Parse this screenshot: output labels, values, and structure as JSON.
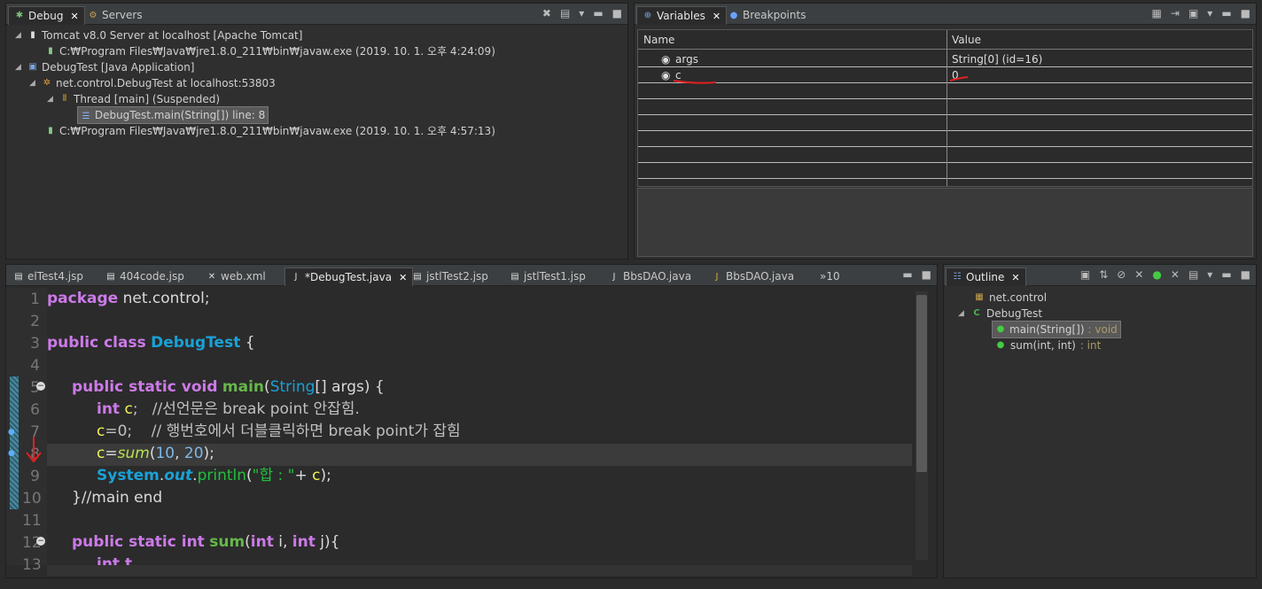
{
  "debug": {
    "tabs": [
      {
        "label": "Debug",
        "close": "✕",
        "icon": "bug-icon"
      },
      {
        "label": "Servers",
        "icon": "servers-icon"
      }
    ],
    "tree": [
      "Tomcat v8.0 Server at localhost [Apache Tomcat]",
      "C:₩Program Files₩Java₩jre1.8.0_211₩bin₩javaw.exe (2019. 10. 1. 오후 4:24:09)",
      "DebugTest [Java Application]",
      "net.control.DebugTest at localhost:53803",
      "Thread [main] (Suspended)",
      "DebugTest.main(String[]) line: 8",
      "C:₩Program Files₩Java₩jre1.8.0_211₩bin₩javaw.exe (2019. 10. 1. 오후 4:57:13)"
    ]
  },
  "variables": {
    "tabs": [
      {
        "label": "Variables",
        "close": "✕"
      },
      {
        "label": "Breakpoints"
      }
    ],
    "headers": {
      "name": "Name",
      "value": "Value"
    },
    "rows": [
      {
        "name": "args",
        "value": "String[0]  (id=16)"
      },
      {
        "name": "c",
        "value": "0"
      }
    ]
  },
  "editor": {
    "tabs": [
      "elTest4.jsp",
      "404code.jsp",
      "web.xml",
      "*DebugTest.java",
      "jstlTest2.jsp",
      "jstlTest1.jsp",
      "BbsDAO.java",
      "BbsDAO.java",
      "»10"
    ],
    "active_tab": "*DebugTest.java",
    "line_numbers": [
      "1",
      "2",
      "3",
      "4",
      "5",
      "6",
      "7",
      "8",
      "9",
      "10",
      "11",
      "12",
      "13"
    ],
    "code": {
      "l1a": "package",
      "l1b": " net.control;",
      "l3a": "public class",
      "l3b": "DebugTest",
      "l3c": " {",
      "l5a": "public static void",
      "l5b": "main",
      "l5c": "(",
      "l5d": "String",
      "l5e": "[] args) {",
      "l6a": "int",
      "l6b": " c",
      "l6c": ";   //선언문은 break point 안잡힘.",
      "l7a": "c",
      "l7b": "=0;    // 행번호에서 더블클릭하면 break point가 잡힘",
      "l8a": "c",
      "l8b": "=",
      "l8c": "sum",
      "l8d": "(",
      "l8e": "10",
      "l8f": ", ",
      "l8g": "20",
      "l8h": ");",
      "l9a": "System",
      "l9b": ".",
      "l9c": "out",
      "l9d": ".",
      "l9e": "println",
      "l9f": "(",
      "l9g": "\"합 : \"",
      "l9h": "+ ",
      "l9i": "c",
      "l9j": ");",
      "l10": "}//main end",
      "l12a": "public static int",
      "l12b": "sum",
      "l12c": "(",
      "l12d": "int",
      "l12e": " i, ",
      "l12f": "int",
      "l12g": " j){",
      "l13a": "int t"
    }
  },
  "outline": {
    "tab": {
      "label": "Outline",
      "close": "✕"
    },
    "items": [
      {
        "label": "net.control"
      },
      {
        "label": "DebugTest"
      },
      {
        "label": "main(String[])",
        "type": " : void"
      },
      {
        "label": "sum(int, int)",
        "type": " : int"
      }
    ]
  },
  "colors": {
    "keyword": "#cc7ae8",
    "class": "#1aa1d6",
    "method": "#21c13d",
    "variable": "#f2f257",
    "number": "#7eb7e8"
  }
}
